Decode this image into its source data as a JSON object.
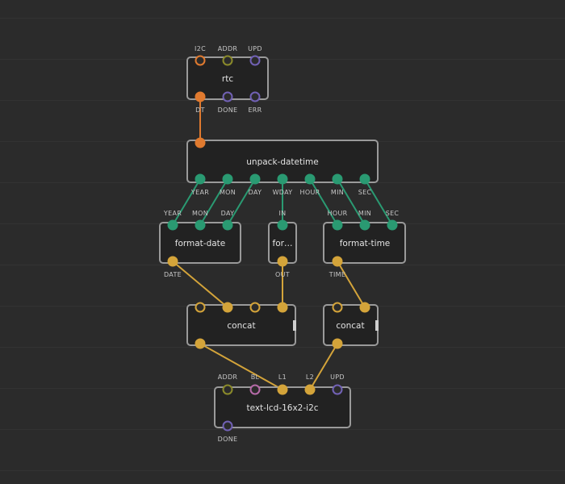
{
  "colors": {
    "background": "#2b2b2b",
    "grid": "#333333",
    "node_fill": "#222222",
    "node_border": "#9a9a9a",
    "pulse": "#7161b5",
    "datetime": "#e07a2f",
    "number": "#2a9a72",
    "string": "#d4a43a",
    "port": "#8a8a2a",
    "byte": "#b66aa8",
    "link_datetime": "#e07a2f",
    "link_number": "#2a9a72",
    "link_string": "#d4a43a"
  },
  "nodes": {
    "rtc": {
      "title": "rtc",
      "inputs": {
        "i2c": "I2C",
        "addr": "ADDR",
        "upd": "UPD"
      },
      "outputs": {
        "dt": "DT",
        "done": "DONE",
        "err": "ERR"
      }
    },
    "unpack": {
      "title": "unpack-datetime",
      "outputs": {
        "year": "YEAR",
        "mon": "MON",
        "day": "DAY",
        "wday": "WDAY",
        "hour": "HOUR",
        "min": "MIN",
        "sec": "SEC"
      }
    },
    "format_date": {
      "title": "format-date",
      "inputs": {
        "year": "YEAR",
        "mon": "MON",
        "day": "DAY"
      },
      "outputs": {
        "date": "DATE"
      }
    },
    "format_wday": {
      "title": "for…",
      "inputs": {
        "in": "IN"
      },
      "outputs": {
        "out": "OUT"
      }
    },
    "format_time": {
      "title": "format-time",
      "inputs": {
        "hour": "HOUR",
        "min": "MIN",
        "sec": "SEC"
      },
      "outputs": {
        "time": "TIME"
      }
    },
    "concat_1": {
      "title": "concat"
    },
    "concat_2": {
      "title": "concat"
    },
    "lcd": {
      "title": "text-lcd-16x2-i2c",
      "inputs": {
        "addr": "ADDR",
        "bl": "BL",
        "l1": "L1",
        "l2": "L2",
        "upd": "UPD"
      },
      "outputs": {
        "done": "DONE"
      }
    }
  }
}
